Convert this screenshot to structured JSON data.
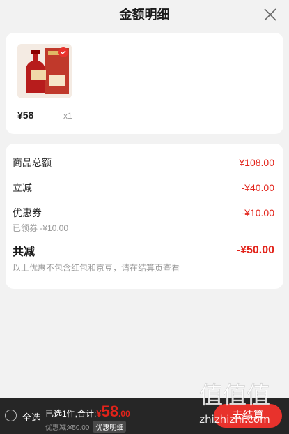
{
  "header": {
    "title": "金额明细",
    "close_icon": "close-icon"
  },
  "product": {
    "image": "liquor-gift-box",
    "price": "¥58",
    "quantity": "x1"
  },
  "details": {
    "total_goods": {
      "label": "商品总额",
      "value": "¥108.00"
    },
    "instant_discount": {
      "label": "立减",
      "value": "-¥40.00"
    },
    "coupon": {
      "label": "优惠券",
      "value": "-¥10.00",
      "sub": "已领券 -¥10.00"
    },
    "total_reduction": {
      "label": "共减",
      "value": "-¥50.00"
    },
    "note": "以上优惠不包含红包和京豆，请在结算页查看"
  },
  "bottom_bar": {
    "select_all": "全选",
    "selected_text": "已选1件,合计:",
    "sum_currency": "¥",
    "sum_int": "58",
    "sum_dec": ".00",
    "discount_text": "优惠减:¥50.00",
    "discount_detail_btn": "优惠明细",
    "checkout_btn": "去结算"
  },
  "watermark": {
    "site": "zhizhizhi.com",
    "logo": "值值值"
  },
  "colors": {
    "accent": "#e2231a",
    "bar": "#262626",
    "checkout": "#e8322c"
  }
}
